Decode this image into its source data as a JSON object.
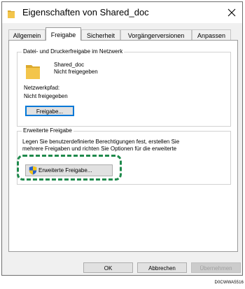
{
  "window": {
    "title": "Eigenschaften von Shared_doc"
  },
  "tabs": [
    {
      "label": "Allgemein",
      "active": false
    },
    {
      "label": "Freigabe",
      "active": true
    },
    {
      "label": "Sicherheit",
      "active": false
    },
    {
      "label": "Vorgängerversionen",
      "active": false
    },
    {
      "label": "Anpassen",
      "active": false
    }
  ],
  "network_sharing": {
    "group_label": "Datei- und Druckerfreigabe im Netzwerk",
    "item_name": "Shared_doc",
    "item_status": "Nicht freigegeben",
    "network_path_label": "Netzwerkpfad:",
    "network_path_value": "Nicht freigegeben",
    "share_button": "Freigabe..."
  },
  "advanced_sharing": {
    "group_label": "Erweiterte Freigabe",
    "description_line1": "Legen Sie benutzerdefinierte Berechtigungen fest, erstellen Sie",
    "description_line2": "mehrere Freigaben und richten Sie Optionen für die erweiterte",
    "button": "Erweiterte Freigabe..."
  },
  "footer": {
    "ok": "OK",
    "cancel": "Abbrechen",
    "apply": "Übernehmen"
  },
  "figure_code": "D0CWWA5516",
  "colors": {
    "highlight": "#1f8a4c",
    "folder": "#f3c54b",
    "shield_blue": "#2a62c9",
    "shield_yellow": "#f5c518",
    "focus": "#0078d7"
  },
  "icons": {
    "title": "folder-icon",
    "close": "close-icon",
    "share_item": "folder-icon",
    "advanced_button": "uac-shield-icon"
  }
}
